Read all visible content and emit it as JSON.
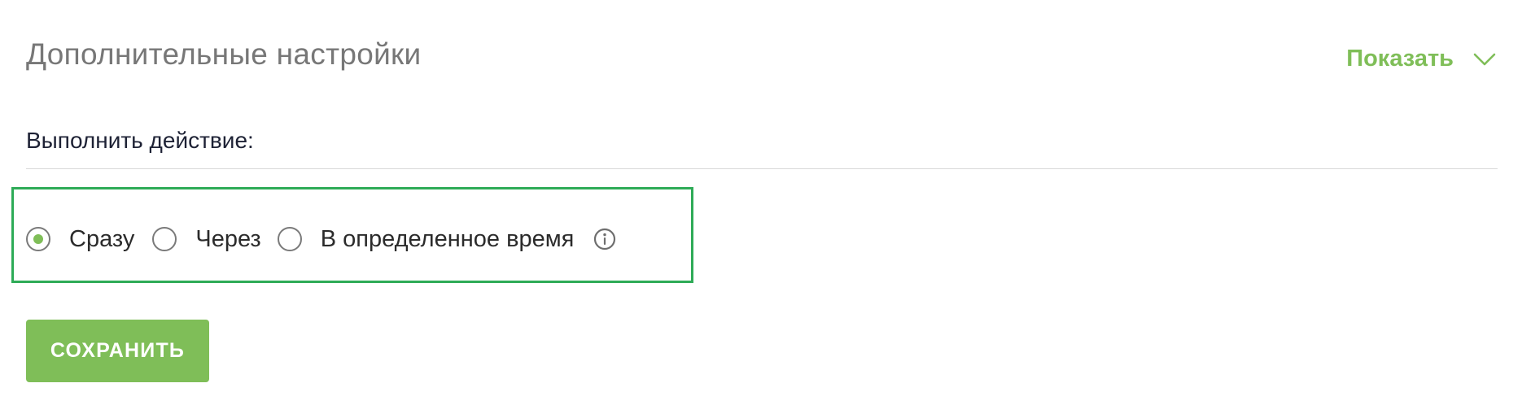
{
  "section": {
    "title": "Дополнительные настройки",
    "toggle_label": "Показать",
    "toggle_icon": "chevron-down-icon"
  },
  "action": {
    "label": "Выполнить действие:",
    "options": [
      {
        "label": "Сразу",
        "selected": true
      },
      {
        "label": "Через",
        "selected": false
      },
      {
        "label": "В определенное время",
        "selected": false
      }
    ],
    "info_icon": "info-icon"
  },
  "save_button": {
    "label": "СОХРАНИТЬ"
  },
  "colors": {
    "accent": "#7fbe58",
    "highlight_border": "#2eab57",
    "title_text": "#777777",
    "divider": "#d9d9d9"
  }
}
